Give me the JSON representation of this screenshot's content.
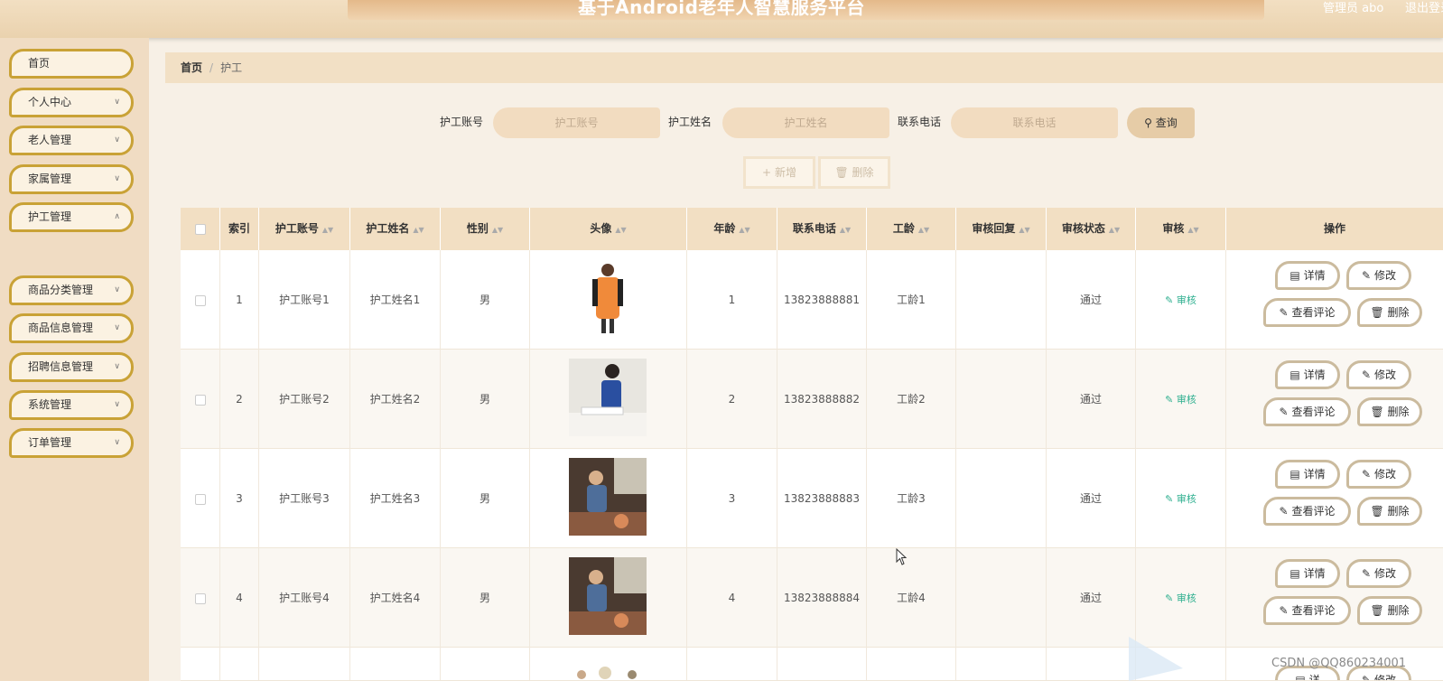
{
  "header": {
    "title": "基于Android老年人智慧服务平台",
    "user": "管理员 abo",
    "logout": "退出登录"
  },
  "sidebar": {
    "items": [
      {
        "label": "首页",
        "has_children": false
      },
      {
        "label": "个人中心",
        "has_children": true
      },
      {
        "label": "老人管理",
        "has_children": true
      },
      {
        "label": "家属管理",
        "has_children": true
      },
      {
        "label": "护工管理",
        "has_children": true
      },
      {
        "label": "商品分类管理",
        "has_children": true
      },
      {
        "label": "商品信息管理",
        "has_children": true
      },
      {
        "label": "招聘信息管理",
        "has_children": true
      },
      {
        "label": "系统管理",
        "has_children": true
      },
      {
        "label": "订单管理",
        "has_children": true
      }
    ],
    "active_sub": "护工"
  },
  "breadcrumb": {
    "home": "首页",
    "separator": "/",
    "current": "护工"
  },
  "search": {
    "account_label": "护工账号",
    "account_placeholder": "护工账号",
    "name_label": "护工姓名",
    "name_placeholder": "护工姓名",
    "phone_label": "联系电话",
    "phone_placeholder": "联系电话",
    "query_label": "查询"
  },
  "actions": {
    "add_label": "新增",
    "delete_label": "删除"
  },
  "table": {
    "columns": [
      "索引",
      "护工账号",
      "护工姓名",
      "性别",
      "头像",
      "年龄",
      "联系电话",
      "工龄",
      "审核回复",
      "审核状态",
      "审核",
      "操作"
    ],
    "rows": [
      {
        "index": "1",
        "account": "护工账号1",
        "name": "护工姓名1",
        "gender": "男",
        "age": "1",
        "phone": "13823888881",
        "seniority": "工龄1",
        "reply": "",
        "status": "通过",
        "audit": "审核"
      },
      {
        "index": "2",
        "account": "护工账号2",
        "name": "护工姓名2",
        "gender": "男",
        "age": "2",
        "phone": "13823888882",
        "seniority": "工龄2",
        "reply": "",
        "status": "通过",
        "audit": "审核"
      },
      {
        "index": "3",
        "account": "护工账号3",
        "name": "护工姓名3",
        "gender": "男",
        "age": "3",
        "phone": "13823888883",
        "seniority": "工龄3",
        "reply": "",
        "status": "通过",
        "audit": "审核"
      },
      {
        "index": "4",
        "account": "护工账号4",
        "name": "护工姓名4",
        "gender": "男",
        "age": "4",
        "phone": "13823888884",
        "seniority": "工龄4",
        "reply": "",
        "status": "通过",
        "audit": "审核"
      }
    ],
    "row_actions": {
      "detail": "详情",
      "edit": "修改",
      "comments": "查看评论",
      "delete": "删除"
    },
    "partial_row_actions": {
      "detail": "详",
      "edit": "修改"
    }
  },
  "watermark": "CSDN @QQ860234001",
  "colors": {
    "accent": "#c9a236",
    "header_bg": "#ead2ae",
    "audit_link": "#2eaf8f"
  }
}
